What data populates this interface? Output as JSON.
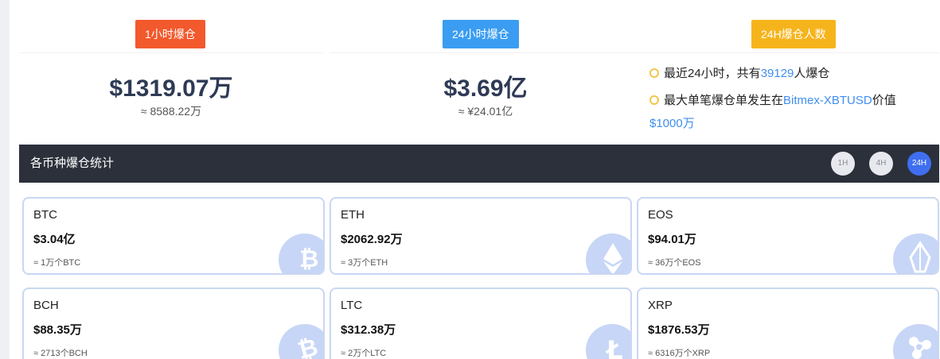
{
  "summary": {
    "one_hour": {
      "badge": "1小时爆仓",
      "badge_color": "#f2592c",
      "amount": "$1319.07万",
      "approx": "≈ 8588.22万"
    },
    "twenty_four_hour": {
      "badge": "24小时爆仓",
      "badge_color": "#3a9df2",
      "amount": "$3.69亿",
      "approx": "≈ ¥24.01亿"
    },
    "people": {
      "badge": "24H爆仓人数",
      "badge_color": "#f6b41c",
      "line1_prefix": "最近24小时，共有",
      "line1_count": "39129",
      "line1_suffix": "人爆仓",
      "line2_prefix": "最大单笔爆仓单发生在",
      "line2_exchange": "Bitmex-XBTUSD",
      "line2_suffix": "价值",
      "line3_value": "$1000万"
    }
  },
  "stats_bar": {
    "title": "各币种爆仓统计",
    "buttons": [
      "1H",
      "4H",
      "24H"
    ],
    "active": "24H"
  },
  "coins": [
    {
      "name": "BTC",
      "value": "$3.04亿",
      "approx": "≈ 1万个BTC",
      "icon": "bitcoin-icon"
    },
    {
      "name": "ETH",
      "value": "$2062.92万",
      "approx": "≈ 3万个ETH",
      "icon": "ethereum-icon"
    },
    {
      "name": "EOS",
      "value": "$94.01万",
      "approx": "≈ 36万个EOS",
      "icon": "eos-icon"
    },
    {
      "name": "BCH",
      "value": "$88.35万",
      "approx": "≈ 2713个BCH",
      "icon": "bitcoin-cash-icon"
    },
    {
      "name": "LTC",
      "value": "$312.38万",
      "approx": "≈ 2万个LTC",
      "icon": "litecoin-icon"
    },
    {
      "name": "XRP",
      "value": "$1876.53万",
      "approx": "≈ 6316万个XRP",
      "icon": "ripple-icon"
    }
  ],
  "colors": {
    "accent_blue": "#3f8ef0",
    "dark_bar": "#2b303b",
    "card_border": "#c9d7f3"
  }
}
